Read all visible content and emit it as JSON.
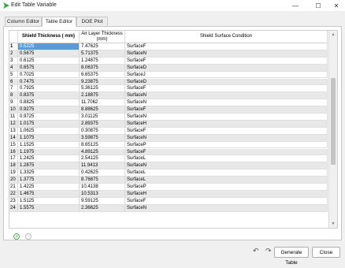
{
  "window": {
    "title": "Edit Table Variable",
    "minimize_glyph": "—",
    "maximize_glyph": "☐",
    "close_glyph": "✕",
    "app_icon": "green-arrow-icon"
  },
  "tabs": [
    {
      "label": "Column Editor",
      "active": false
    },
    {
      "label": "Table Editor",
      "active": true
    },
    {
      "label": "DOE Plot",
      "active": false
    }
  ],
  "table": {
    "columns": [
      "Shield Thickness ( mm)",
      "Air Layer Thickness (mm)",
      "Shield Surface Condition"
    ],
    "rows": [
      [
        "1",
        "0.5225",
        "7.47625",
        "SurfaceF"
      ],
      [
        "2",
        "0.5675",
        "5.71375",
        "SurfaceN"
      ],
      [
        "3",
        "0.6125",
        "1.24875",
        "SurfaceF"
      ],
      [
        "4",
        "0.6575",
        "8.06375",
        "SurfaceD"
      ],
      [
        "5",
        "0.7025",
        "6.65375",
        "SurfaceJ"
      ],
      [
        "6",
        "0.7475",
        "9.23875",
        "SurfaceD"
      ],
      [
        "7",
        "0.7925",
        "5.36125",
        "SurfaceF"
      ],
      [
        "8",
        "0.8375",
        "2.18875",
        "SurfaceN"
      ],
      [
        "9",
        "0.8825",
        "11.7062",
        "SurfaceN"
      ],
      [
        "10",
        "0.9275",
        "8.88625",
        "SurfaceF"
      ],
      [
        "11",
        "0.9725",
        "3.01125",
        "SurfaceN"
      ],
      [
        "12",
        "1.0175",
        "2.89375",
        "SurfaceH"
      ],
      [
        "13",
        "1.0625",
        "0.30875",
        "SurfaceF"
      ],
      [
        "14",
        "1.1075",
        "3.59875",
        "SurfaceN"
      ],
      [
        "15",
        "1.1525",
        "8.65125",
        "SurfaceP"
      ],
      [
        "16",
        "1.1975",
        "4.89125",
        "SurfaceF"
      ],
      [
        "17",
        "1.2425",
        "2.54125",
        "SurfaceL"
      ],
      [
        "18",
        "1.2875",
        "11.9413",
        "SurfaceN"
      ],
      [
        "19",
        "1.3325",
        "0.42625",
        "SurfaceL"
      ],
      [
        "20",
        "1.3775",
        "8.76875",
        "SurfaceL"
      ],
      [
        "21",
        "1.4225",
        "10.4138",
        "SurfaceP"
      ],
      [
        "22",
        "1.4675",
        "10.5313",
        "SurfaceH"
      ],
      [
        "23",
        "1.5125",
        "9.59125",
        "SurfaceF"
      ],
      [
        "24",
        "1.5575",
        "2.36625",
        "SurfaceN"
      ]
    ]
  },
  "actions": {
    "add_row_glyph": "+",
    "remove_row_glyph": "−",
    "undo_glyph": "↶",
    "redo_glyph": "↷",
    "generate_label": "Generate Table",
    "close_label": "Close"
  },
  "colors": {
    "selected_cell": "#5b9bd5",
    "add_icon": "#2e9e3e"
  }
}
